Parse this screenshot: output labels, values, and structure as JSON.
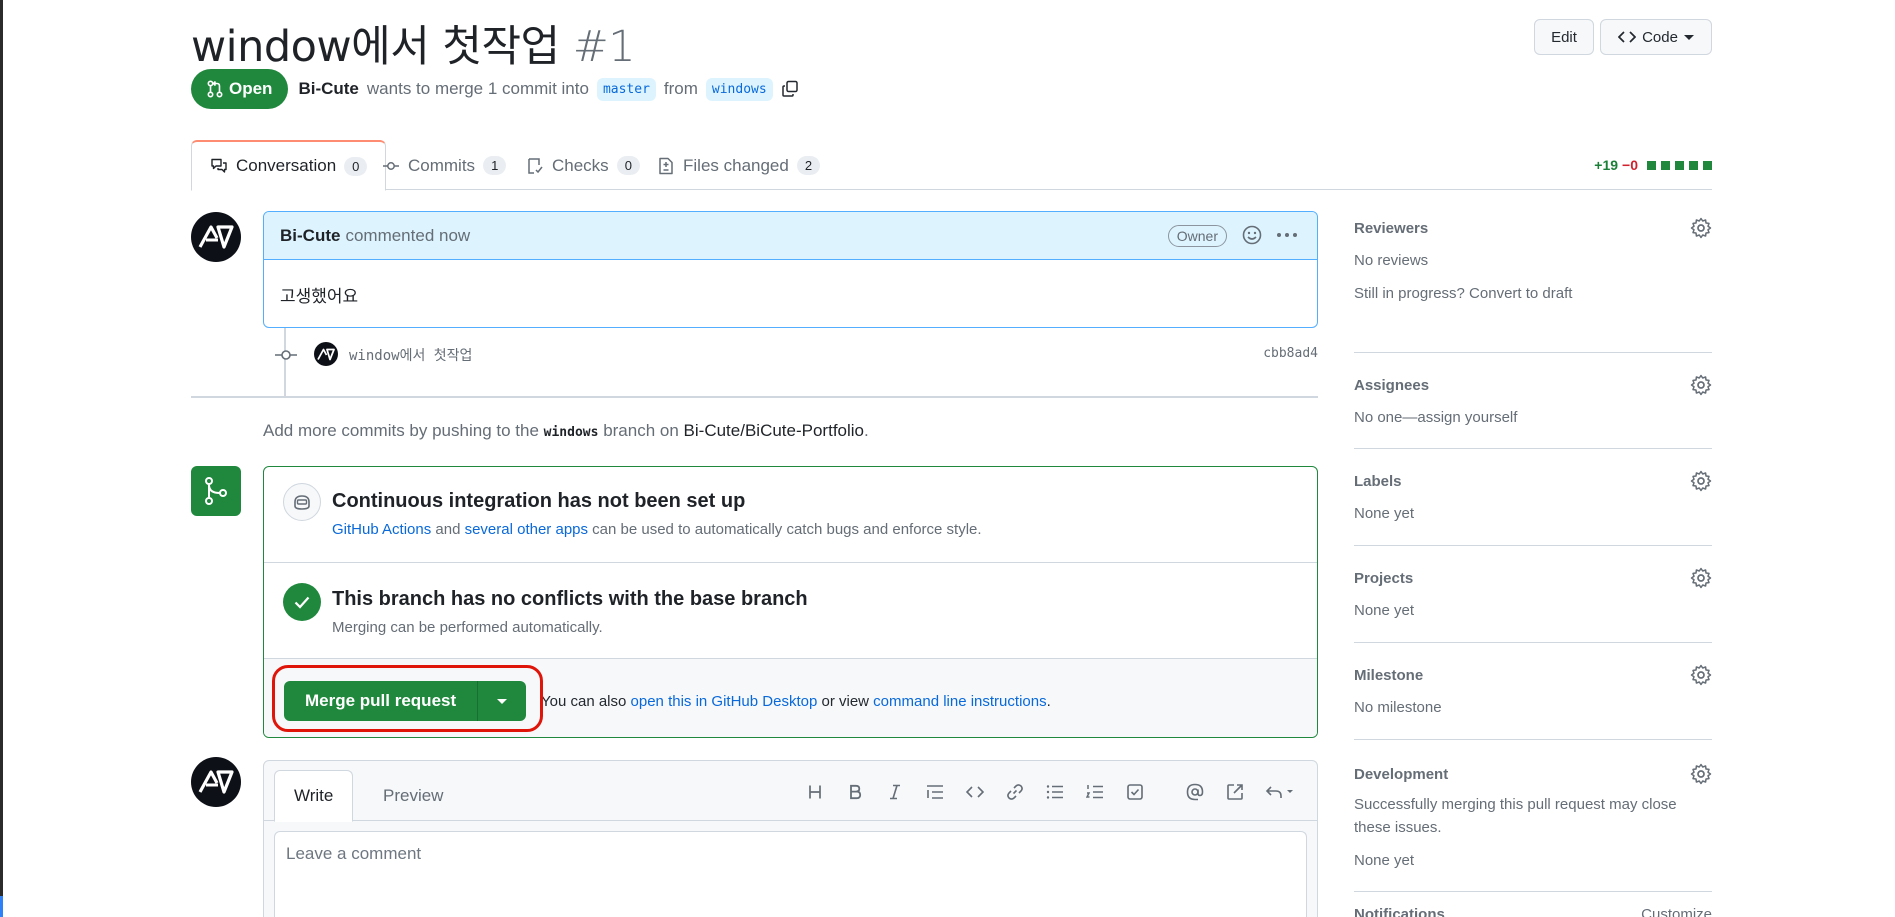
{
  "header": {
    "title": "window에서 첫작업",
    "number": "#1",
    "edit_label": "Edit",
    "code_label": "Code"
  },
  "meta": {
    "state": "Open",
    "author": "Bi-Cute",
    "text_wants": "wants to merge 1 commit into",
    "base_branch": "master",
    "text_from": "from",
    "head_branch": "windows"
  },
  "tabs": [
    {
      "label": "Conversation",
      "count": "0"
    },
    {
      "label": "Commits",
      "count": "1"
    },
    {
      "label": "Checks",
      "count": "0"
    },
    {
      "label": "Files changed",
      "count": "2"
    }
  ],
  "diffstat": {
    "additions": "+19",
    "deletions": "−0",
    "colors": {
      "add": "#1a7f37",
      "del": "#cf222e"
    }
  },
  "comment": {
    "author": "Bi-Cute",
    "action": "commented now",
    "badge": "Owner",
    "body": "고생했어요"
  },
  "commit": {
    "message": "window에서 첫작업",
    "sha": "cbb8ad4"
  },
  "add_commits": {
    "prefix": "Add more commits by pushing to the",
    "branch": "windows",
    "middle": "branch on",
    "repo": "Bi-Cute/BiCute-Portfolio",
    "suffix": "."
  },
  "merge": {
    "ci_title": "Continuous integration has not been set up",
    "ci_link1": "GitHub Actions",
    "ci_and": "and",
    "ci_link2": "several other apps",
    "ci_rest": "can be used to automatically catch bugs and enforce style.",
    "conflict_title": "This branch has no conflicts with the base branch",
    "conflict_sub": "Merging can be performed automatically.",
    "merge_button": "Merge pull request",
    "also_prefix": "You can also",
    "also_link1": "open this in GitHub Desktop",
    "also_or": "or view",
    "also_link2": "command line instructions",
    "also_suffix": ".",
    "accent": "#1f883d"
  },
  "composer": {
    "write_tab": "Write",
    "preview_tab": "Preview",
    "placeholder": "Leave a comment",
    "toolbar": [
      "heading-icon",
      "bold-icon",
      "italic-icon",
      "quote-icon",
      "code-icon",
      "link-icon",
      "unordered-list-icon",
      "ordered-list-icon",
      "task-list-icon",
      "mention-icon",
      "reference-icon",
      "reply-icon"
    ]
  },
  "sidebar": {
    "reviewers": {
      "title": "Reviewers",
      "line1": "No reviews",
      "line2": "Still in progress? Convert to draft"
    },
    "assignees": {
      "title": "Assignees",
      "line1": "No one—assign yourself"
    },
    "labels": {
      "title": "Labels",
      "line1": "None yet"
    },
    "projects": {
      "title": "Projects",
      "line1": "None yet"
    },
    "milestone": {
      "title": "Milestone",
      "line1": "No milestone"
    },
    "development": {
      "title": "Development",
      "line1": "Successfully merging this pull request may close these issues.",
      "line2": "None yet"
    },
    "notifications": {
      "title": "Notifications",
      "action": "Customize"
    }
  }
}
